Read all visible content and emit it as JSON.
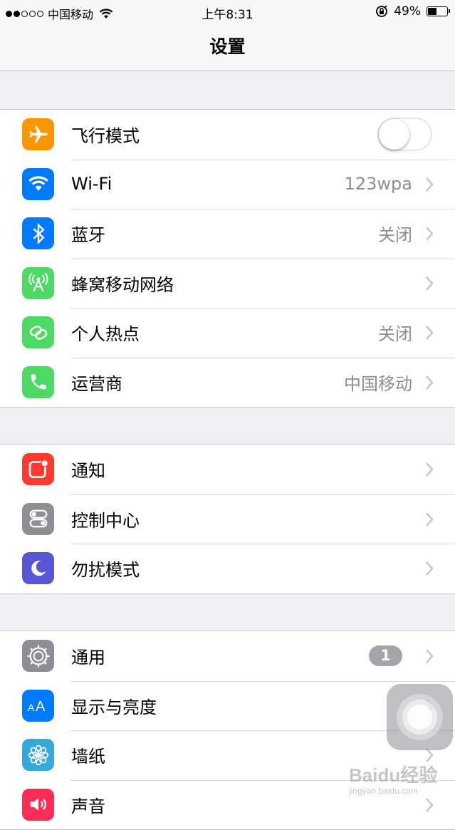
{
  "status_bar": {
    "carrier": "中国移动",
    "time": "上午8:31",
    "battery": "49%",
    "battery_level": 0.49,
    "signal_strength": 2
  },
  "nav": {
    "title": "设置"
  },
  "groups": [
    {
      "items": [
        {
          "label": "飞行模式",
          "icon": "airplane-icon",
          "color": "#ff9500",
          "toggle": false
        },
        {
          "label": "Wi-Fi",
          "value": "123wpa",
          "icon": "wifi-icon",
          "color": "#007aff"
        },
        {
          "label": "蓝牙",
          "value": "关闭",
          "icon": "bluetooth-icon",
          "color": "#007aff"
        },
        {
          "label": "蜂窝移动网络",
          "icon": "cellular-icon",
          "color": "#4cd964"
        },
        {
          "label": "个人热点",
          "value": "关闭",
          "icon": "hotspot-icon",
          "color": "#4cd964"
        },
        {
          "label": "运营商",
          "value": "中国移动",
          "icon": "phone-icon",
          "color": "#4cd964"
        }
      ]
    },
    {
      "items": [
        {
          "label": "通知",
          "icon": "notifications-icon",
          "color": "#ff3b30"
        },
        {
          "label": "控制中心",
          "icon": "control-center-icon",
          "color": "#8e8e93"
        },
        {
          "label": "勿扰模式",
          "icon": "moon-icon",
          "color": "#5856d6"
        }
      ]
    },
    {
      "items": [
        {
          "label": "通用",
          "badge": "1",
          "icon": "gear-icon",
          "color": "#8e8e93"
        },
        {
          "label": "显示与亮度",
          "icon": "display-icon",
          "color": "#007aff"
        },
        {
          "label": "墙纸",
          "icon": "wallpaper-icon",
          "color": "#34aadc"
        },
        {
          "label": "声音",
          "icon": "speaker-icon",
          "color": "#ff2d55"
        }
      ]
    }
  ],
  "watermark": {
    "main": "Baidu经验",
    "sub": "jingyan.baidu.com"
  },
  "colors": {
    "background": "#efeff4",
    "separator": "#c8c7cc",
    "secondary_text": "#8e8e93"
  }
}
